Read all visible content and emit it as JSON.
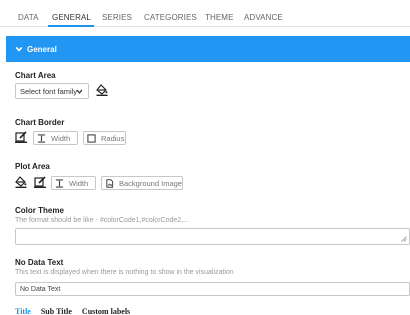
{
  "tabs": [
    {
      "label": "DATA",
      "active": false
    },
    {
      "label": "GENERAL",
      "active": true
    },
    {
      "label": "SERIES",
      "active": false
    },
    {
      "label": "CATEGORIES",
      "active": false
    },
    {
      "label": "THEME",
      "active": false
    },
    {
      "label": "ADVANCE",
      "active": false
    }
  ],
  "header": {
    "title": "General",
    "icon": "chevron-down-icon",
    "color": "#2196f3"
  },
  "chart_area": {
    "title": "Chart Area",
    "font_select": {
      "value": "Select font family"
    },
    "icon": "fill-bucket-icon"
  },
  "chart_border": {
    "title": "Chart Border",
    "icon": "border-edit-icon",
    "width_label": "Width",
    "radius_label": "Radius"
  },
  "plot_area": {
    "title": "Plot Area",
    "width_label": "Width",
    "background_label": "Background Image"
  },
  "color_theme": {
    "title": "Color Theme",
    "hint": "The format should be like - #colorCode1,#colorCode2,...",
    "value": ""
  },
  "no_data": {
    "title": "No Data Text",
    "hint": "This text is displayed when there is nothing to show in the visualization",
    "value": "No Data Text"
  },
  "subtabs": [
    {
      "label": "Title",
      "active": true
    },
    {
      "label": "Sub Title",
      "active": false
    },
    {
      "label": "Custom labels",
      "active": false
    }
  ],
  "accent_color": "#1b94e9"
}
